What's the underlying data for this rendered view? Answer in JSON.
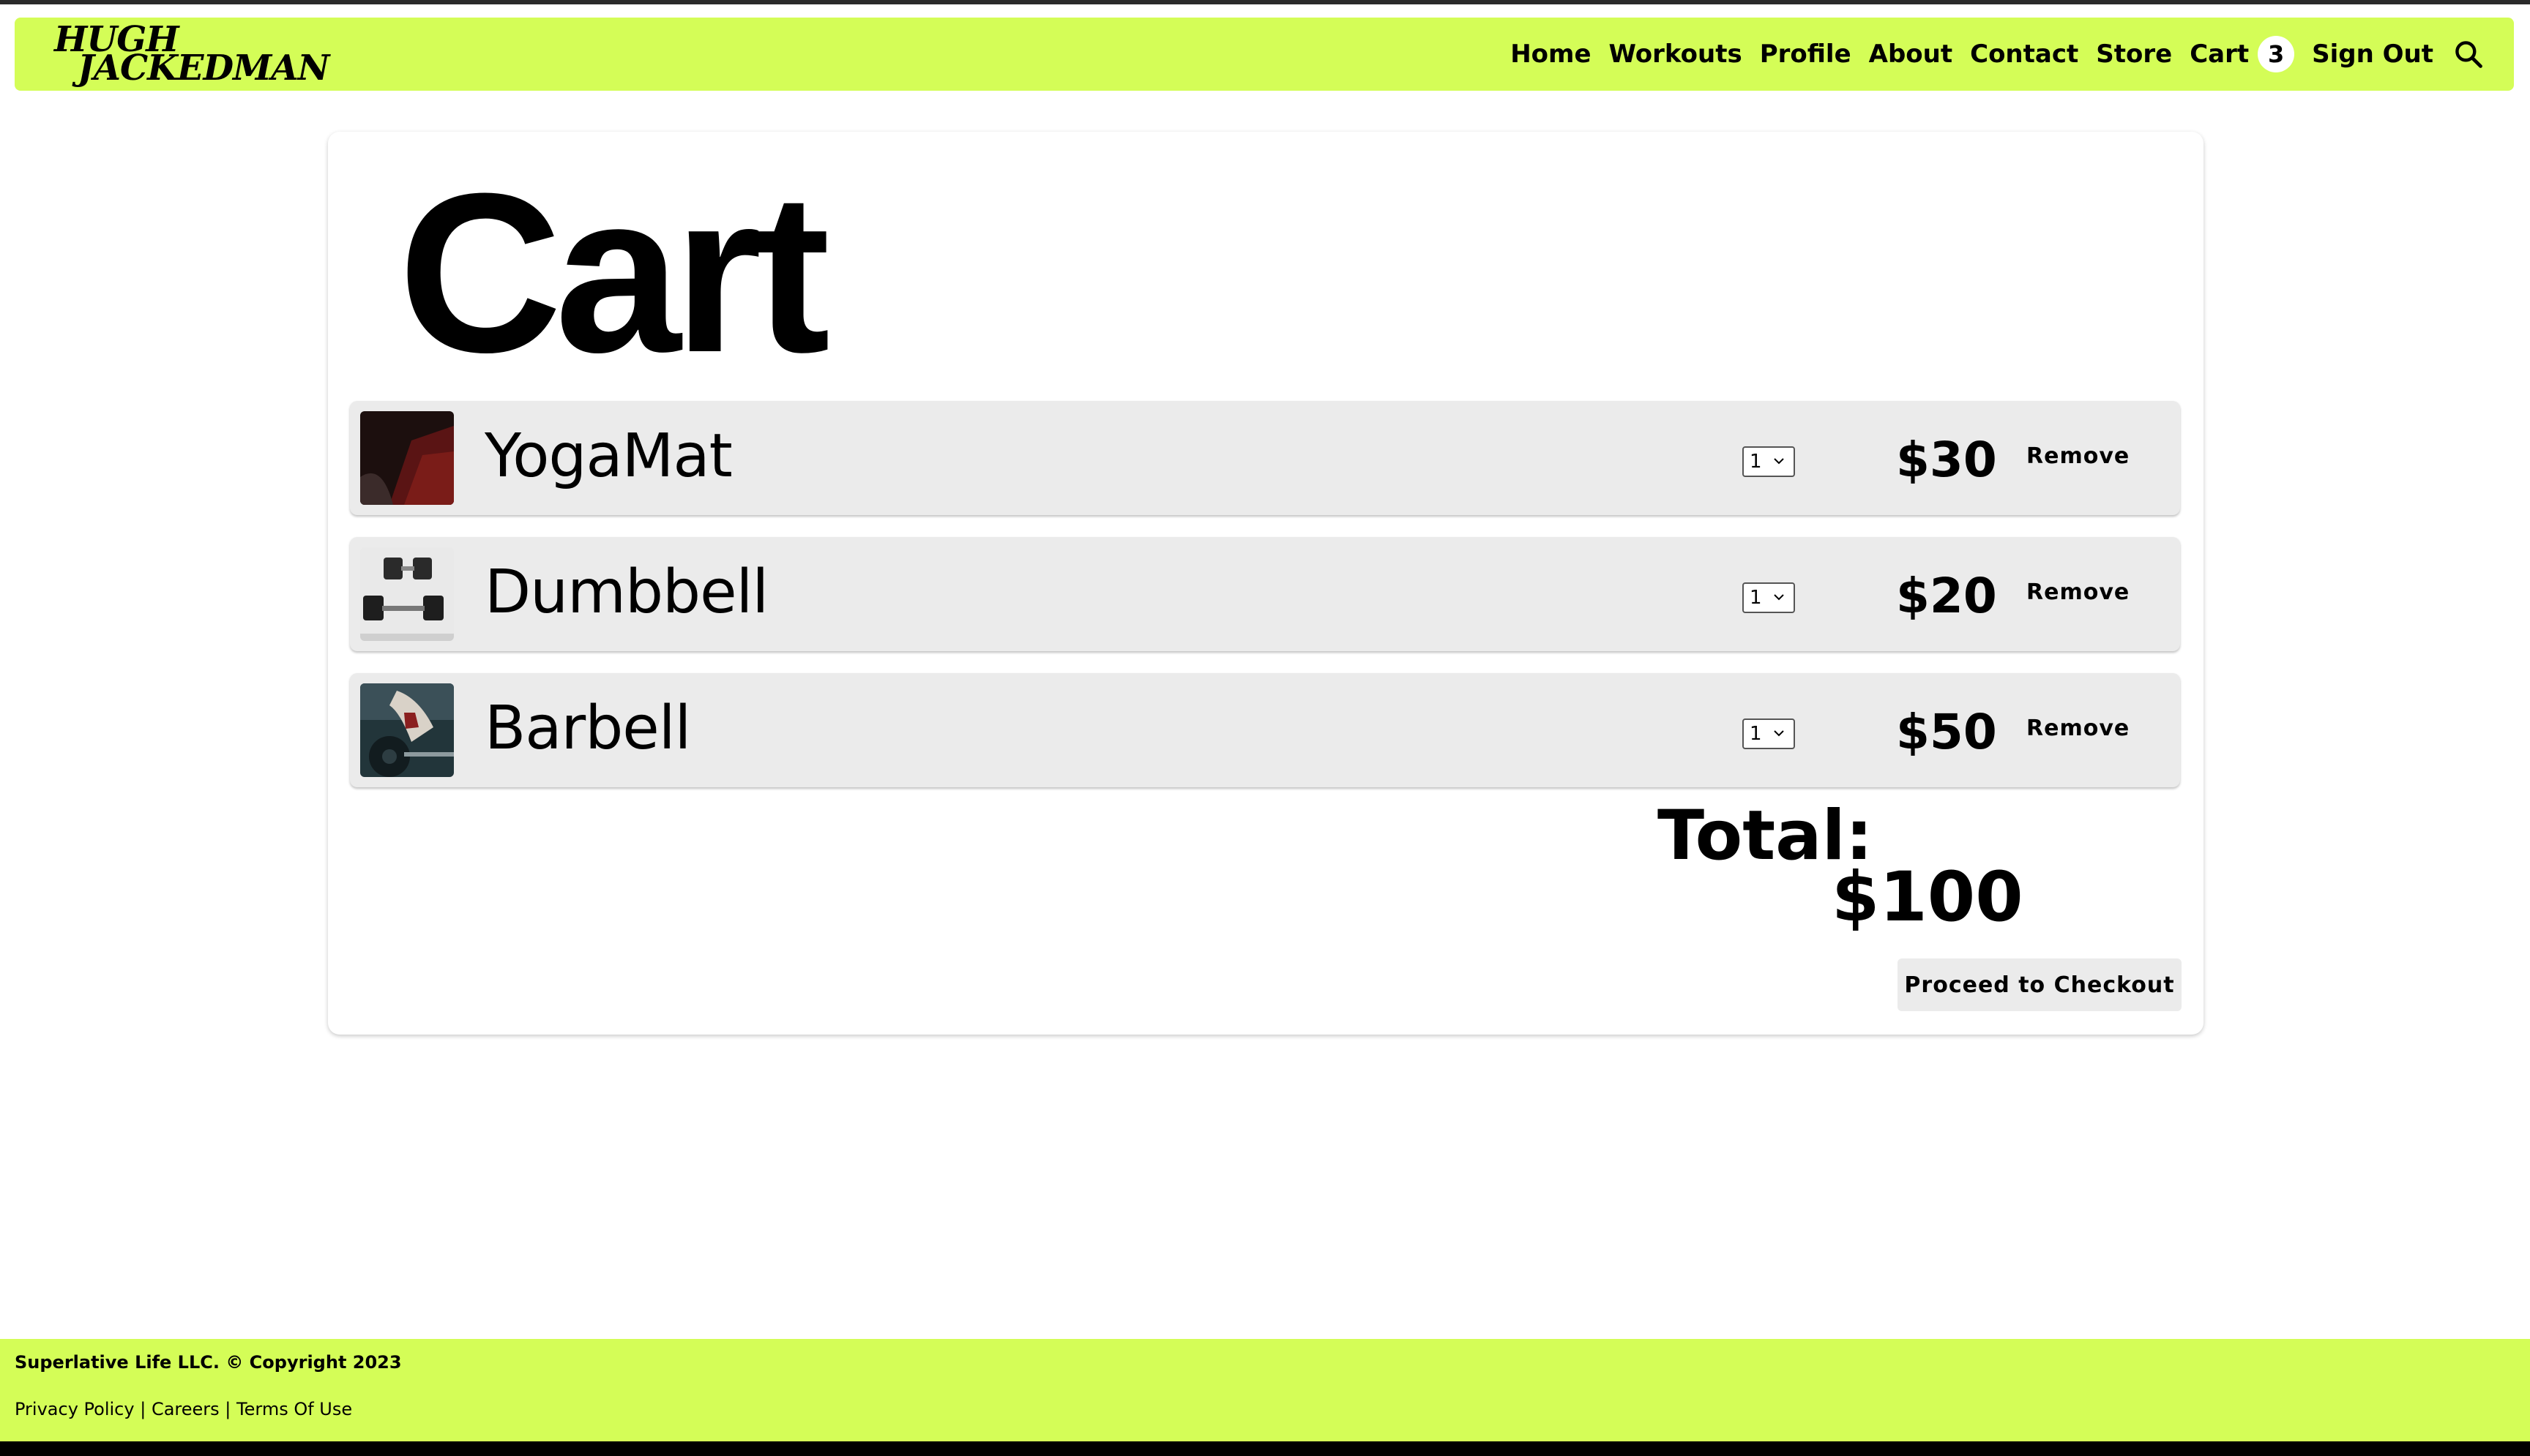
{
  "brand": {
    "line1": "HUGH",
    "line2": "JACKEDMAN"
  },
  "nav": {
    "items": [
      "Home",
      "Workouts",
      "Profile",
      "About",
      "Contact",
      "Store"
    ],
    "cart_label": "Cart",
    "cart_count": "3",
    "sign_out": "Sign Out",
    "search_icon": "search-icon"
  },
  "page": {
    "title": "Cart"
  },
  "cart": {
    "items": [
      {
        "name": "YogaMat",
        "qty": "1",
        "price": "$30",
        "remove": "Remove",
        "thumb": "yoga-mat-photo"
      },
      {
        "name": "Dumbbell",
        "qty": "1",
        "price": "$20",
        "remove": "Remove",
        "thumb": "dumbbell-photo"
      },
      {
        "name": "Barbell",
        "qty": "1",
        "price": "$50",
        "remove": "Remove",
        "thumb": "barbell-photo"
      }
    ],
    "total_label": "Total:",
    "total_value": "$100",
    "checkout": "Proceed to Checkout"
  },
  "footer": {
    "copyright": "Superlative Life LLC. © Copyright 2023",
    "links": [
      "Privacy Policy",
      "Careers",
      "Terms Of Use"
    ],
    "separator": "|"
  },
  "colors": {
    "accent": "#d4fd57",
    "row_bg": "#ebebeb",
    "text": "#000000"
  }
}
